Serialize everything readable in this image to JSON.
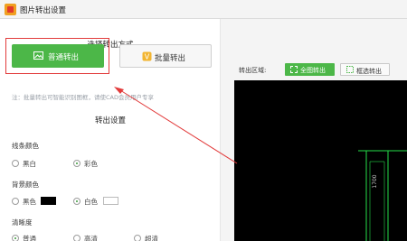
{
  "window": {
    "title": "图片转出设置"
  },
  "mode": {
    "title": "选择转出方式",
    "normal_label": "普通转出",
    "batch_label": "批量转出",
    "note": "注：批量转出可智能识别图框，请使CAD会员用户专享"
  },
  "settings": {
    "title": "转出设置",
    "line_color": {
      "label": "线条颜色",
      "opt1": "黑白",
      "opt2": "彩色",
      "selected": "彩色"
    },
    "bg_color": {
      "label": "背景颜色",
      "opt1": "黑色",
      "opt2": "白色",
      "selected": "白色"
    },
    "clarity": {
      "label": "清晰度",
      "opt1": "普通",
      "opt2": "高清",
      "opt3": "超清",
      "selected": "普通"
    }
  },
  "preview": {
    "area_label": "转出区域:",
    "full_label": "全图转出",
    "box_label": "框选转出",
    "dimension_text": "1700"
  },
  "colors": {
    "accent": "#4cb748",
    "highlight": "#e23b3b",
    "cad_line": "#26e04a",
    "swatch_black": "#000000",
    "swatch_white": "#ffffff"
  }
}
